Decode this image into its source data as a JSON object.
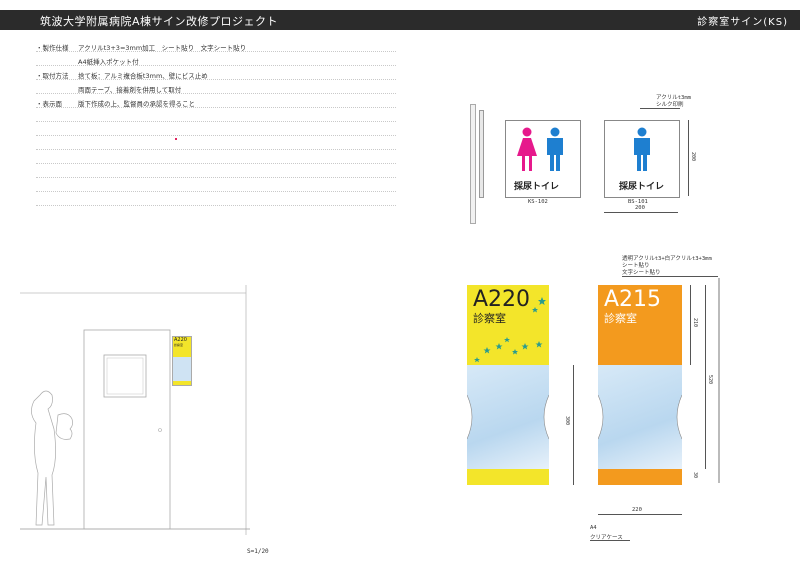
{
  "header": {
    "title": "筑波大学附属病院A棟サイン改修プロジェクト",
    "subtitle": "診察室サイン(KS)"
  },
  "specs": [
    {
      "label": "・製作仕様",
      "value": "アクリルt3+3=3mm加工　シート貼り　文字シート貼り"
    },
    {
      "label": "",
      "value": "A4紙挿入ポケット付"
    },
    {
      "label": "・取付方法",
      "value": "捨て板：アルミ複合板t3mm、壁にビス止め"
    },
    {
      "label": "",
      "value": "両面テープ、接着剤を併用して取付"
    },
    {
      "label": "・表示面",
      "value": "版下作成の上、監督員の承認を得ること"
    }
  ],
  "toilet_signs": [
    {
      "text": "採尿トイレ",
      "code": "KS-102"
    },
    {
      "text": "採尿トイレ",
      "code": "BS-101"
    }
  ],
  "toilet_notes": {
    "material": "アクリルt3mm",
    "print": "シルク印刷",
    "dim_height": "200",
    "dim_width": "200"
  },
  "room_signs": [
    {
      "number": "A220",
      "room": "診察室",
      "color": "#f3e52a"
    },
    {
      "number": "A215",
      "room": "診察室",
      "color": "#f39a1e"
    }
  ],
  "room_notes": {
    "line1": "透明アクリルt3+白アクリルt3+3mm",
    "line2": "シート貼り",
    "line3": "文字シート貼り",
    "dim_top": "210",
    "dim_mid": "520",
    "dim_bottom": "30",
    "dim_window": "300",
    "dim_width": "220",
    "pocket_size": "A4",
    "pocket_type": "クリアケース"
  },
  "elevation": {
    "mini_number": "A220",
    "mini_room": "診察室",
    "scale": "S=1/20"
  }
}
